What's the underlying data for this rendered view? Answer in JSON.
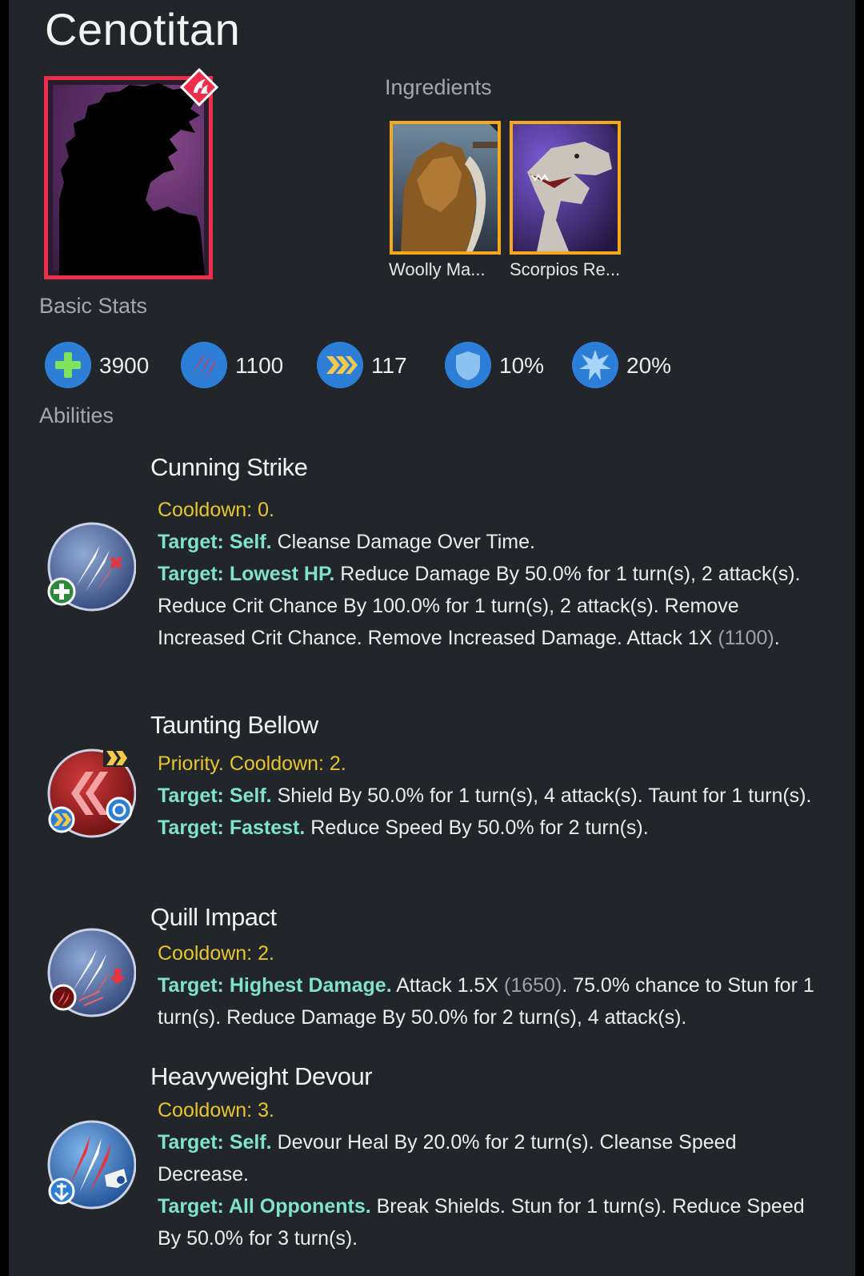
{
  "creature": {
    "name": "Cenotitan"
  },
  "sections": {
    "ingredients": "Ingredients",
    "basic_stats": "Basic Stats",
    "abilities": "Abilities"
  },
  "ingredients": [
    {
      "name": "Woolly Ma..."
    },
    {
      "name": "Scorpios Re..."
    }
  ],
  "stats": {
    "health": "3900",
    "damage": "1100",
    "speed": "117",
    "armor": "10%",
    "crit": "20%"
  },
  "abilities": [
    {
      "name": "Cunning Strike",
      "cooldown": "Cooldown: 0.",
      "lines": [
        {
          "target": "Target: Self.",
          "text": " Cleanse Damage Over Time."
        },
        {
          "target": "Target: Lowest HP.",
          "text": " Reduce Damage By 50.0% for 1 turn(s), 2 attack(s). Reduce Crit Chance By 100.0% for 1 turn(s), 2 attack(s). Remove Increased Crit Chance. Remove Increased Damage. Attack 1X ",
          "num": "(1100)",
          "tail": "."
        }
      ]
    },
    {
      "name": "Taunting Bellow",
      "cooldown": "Priority. Cooldown: 2.",
      "lines": [
        {
          "target": "Target: Self.",
          "text": " Shield By 50.0% for 1 turn(s), 4 attack(s). Taunt for 1 turn(s)."
        },
        {
          "target": "Target: Fastest.",
          "text": " Reduce Speed By 50.0% for 2 turn(s)."
        }
      ]
    },
    {
      "name": "Quill Impact",
      "cooldown": "Cooldown: 2.",
      "lines": [
        {
          "target": "Target: Highest Damage.",
          "text": " Attack 1.5X ",
          "num": "(1650)",
          "tail": ". 75.0% chance to Stun for 1 turn(s). Reduce Damage By 50.0% for 2 turn(s), 4 attack(s)."
        }
      ]
    },
    {
      "name": "Heavyweight Devour",
      "cooldown": "Cooldown: 3.",
      "lines": [
        {
          "target": "Target: Self.",
          "text": " Devour Heal By 20.0% for 2 turn(s). Cleanse Speed Decrease."
        },
        {
          "target": "Target: All Opponents.",
          "text": " Break Shields. Stun for 1 turn(s). Reduce Speed By 50.0% for 3 turn(s)."
        }
      ]
    }
  ],
  "colors": {
    "background": "#22252a",
    "rarity_border": "#ee2d4a",
    "ingredient_border": "#f6a81c",
    "cooldown_text": "#e6c62c",
    "target_text": "#7fe3cc",
    "stat_icon": "#2c7ed6"
  },
  "icons": {
    "rarity": "hybrid-rarity-icon",
    "health": "health-plus-icon",
    "damage": "damage-claw-icon",
    "speed": "speed-chevron-icon",
    "armor": "armor-shield-icon",
    "crit": "crit-burst-icon"
  }
}
